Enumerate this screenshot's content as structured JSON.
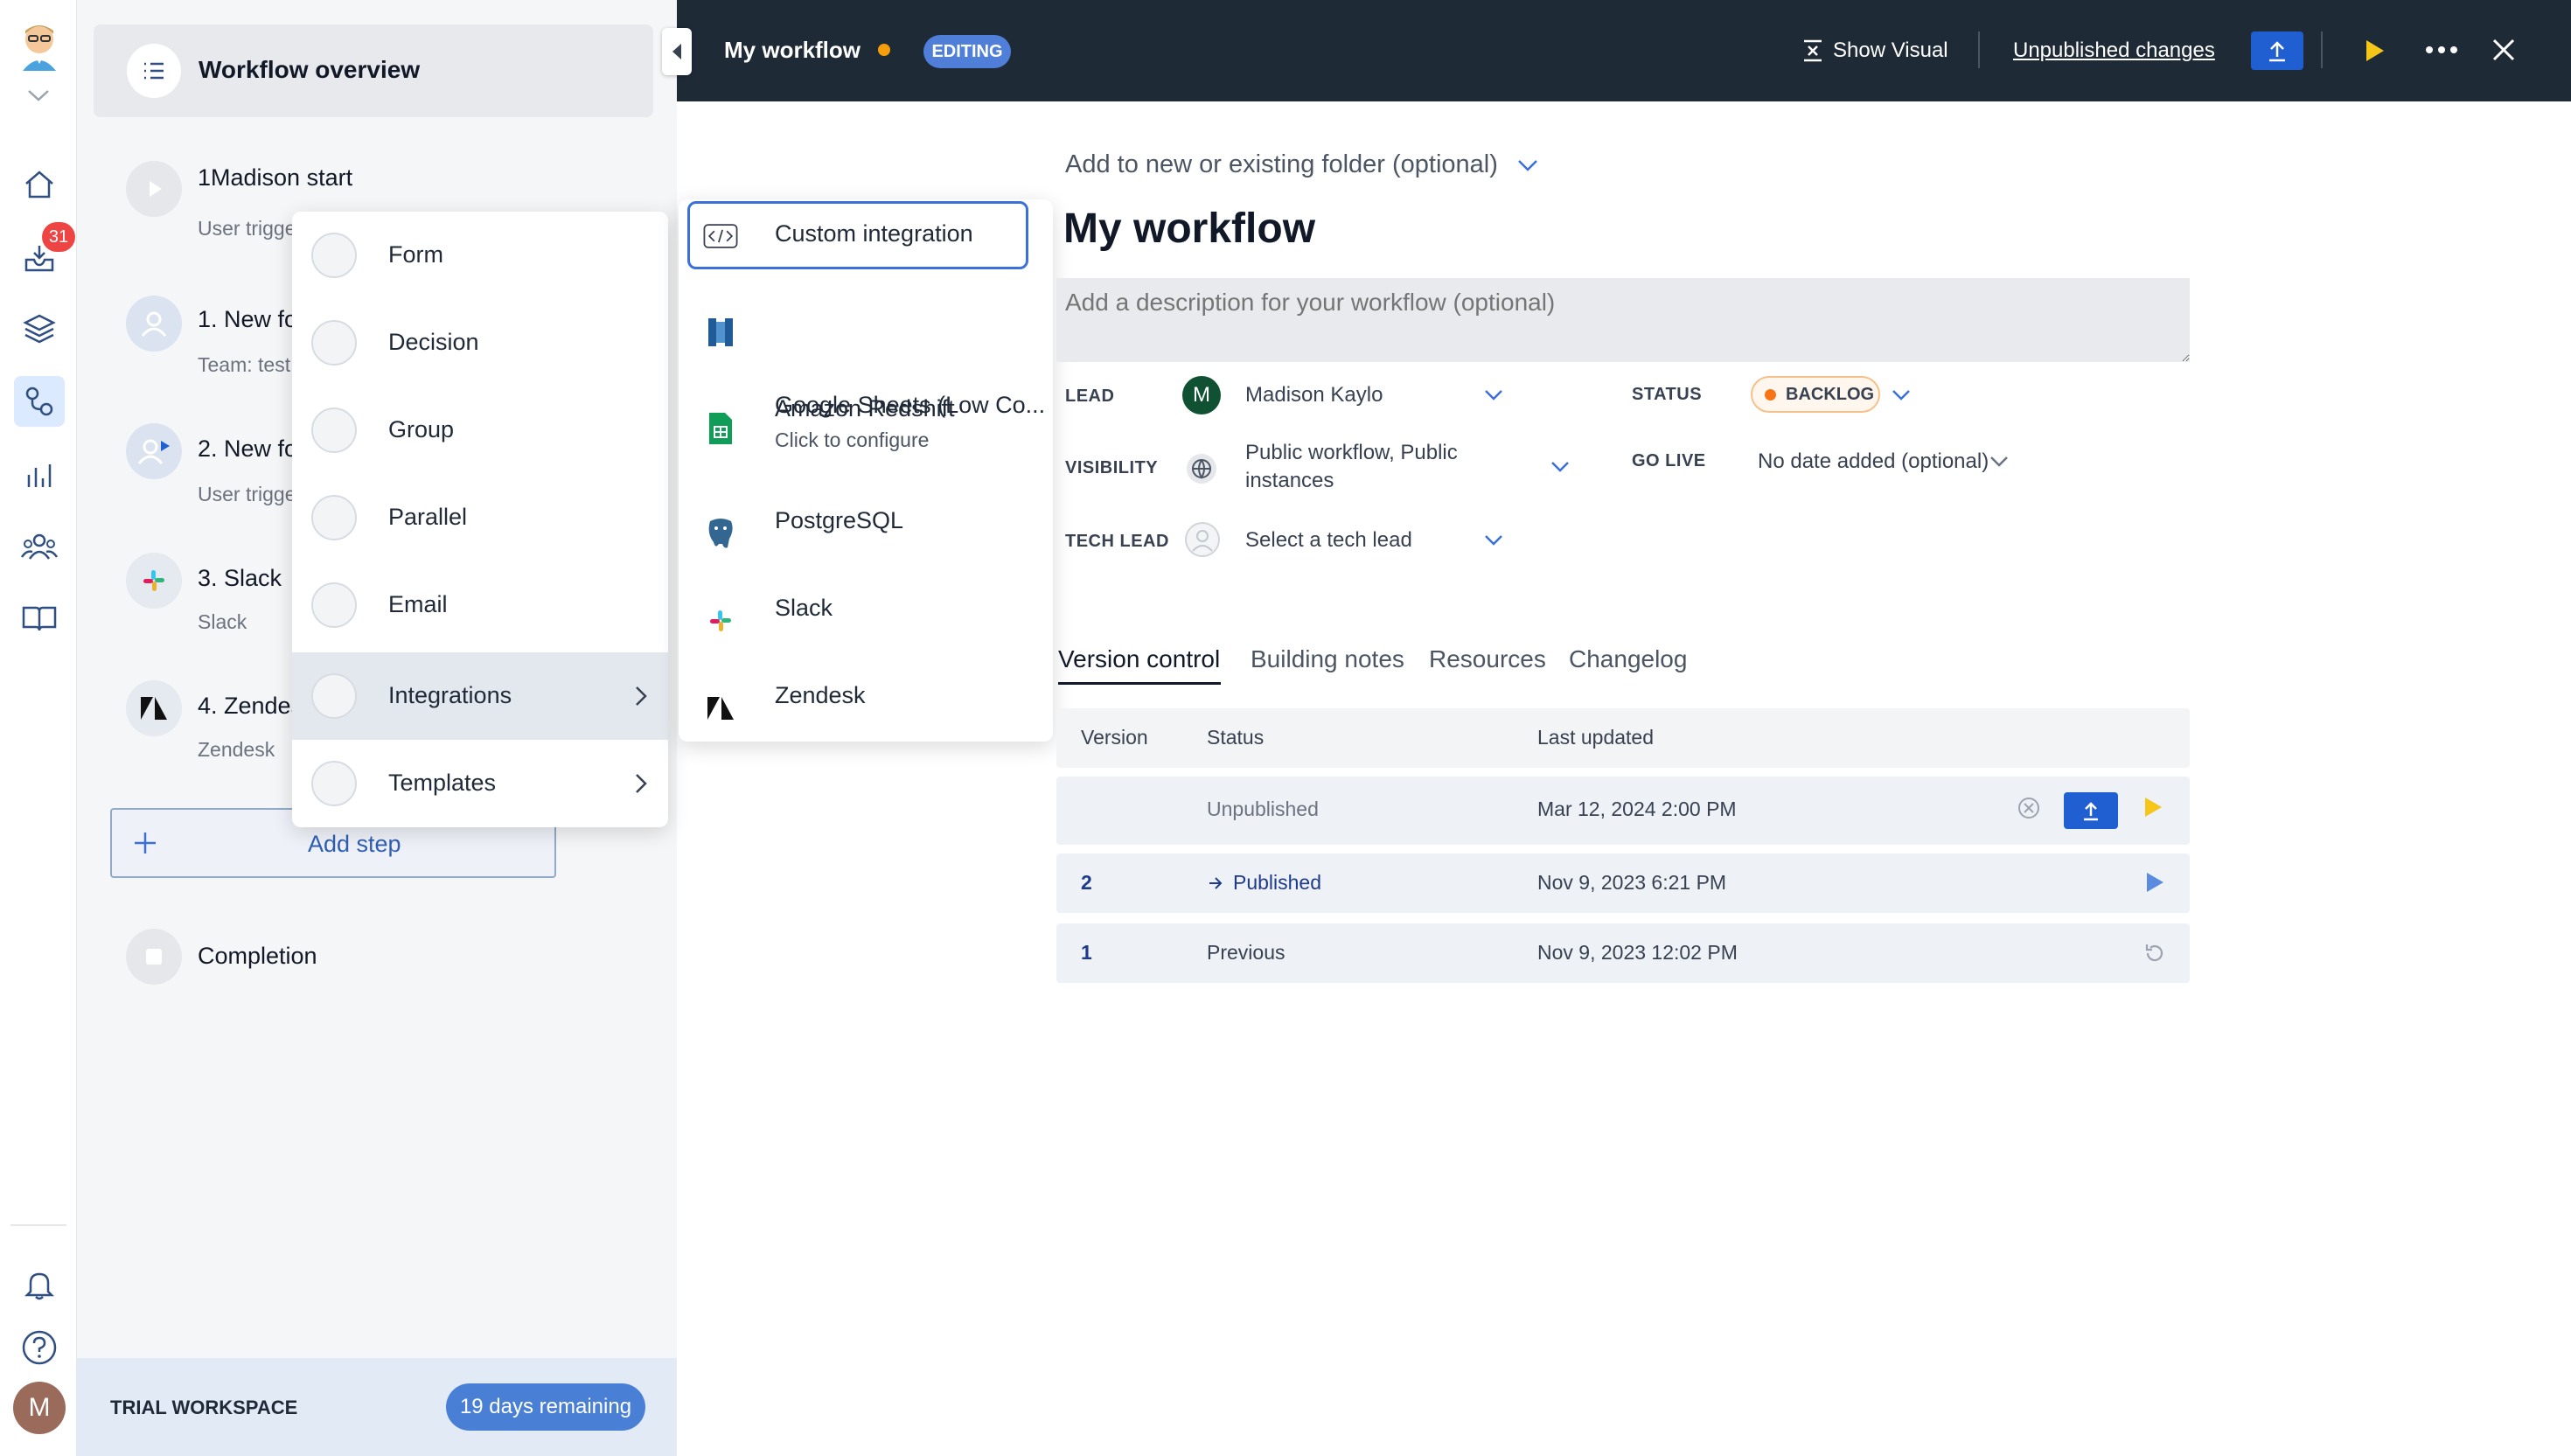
{
  "topbar": {
    "title": "My workflow",
    "mode_badge": "EDITING",
    "show_visual": "Show Visual",
    "unpublished_changes": "Unpublished changes"
  },
  "rail": {
    "inbox_count": "31",
    "avatar_initial": "M"
  },
  "sidebar": {
    "overview": "Workflow overview",
    "steps": [
      {
        "title": "1Madison start",
        "sub": "User trigge"
      },
      {
        "title": "1. New fo",
        "sub": "Team: test"
      },
      {
        "title": "2. New fo",
        "sub": "User trigge"
      },
      {
        "title": "3. Slack",
        "sub": "Slack"
      },
      {
        "title": "4. Zendes",
        "sub": "Zendesk"
      }
    ],
    "add_step": "Add step",
    "completion": "Completion",
    "trial_label": "TRIAL WORKSPACE",
    "days_remaining": "19 days remaining"
  },
  "step_menu": {
    "items": [
      "Form",
      "Decision",
      "Group",
      "Parallel",
      "Email",
      "Integrations",
      "Templates"
    ]
  },
  "integrations_menu": {
    "items": [
      {
        "label": "Custom integration",
        "icon": "code-icon"
      },
      {
        "label": "Amazon Redshift",
        "icon": "redshift-icon"
      },
      {
        "label": "Google Sheets (Low Co...",
        "sub": "Click to configure",
        "icon": "sheets-icon"
      },
      {
        "label": "PostgreSQL",
        "icon": "postgres-icon"
      },
      {
        "label": "Slack",
        "icon": "slack-icon"
      },
      {
        "label": "Zendesk",
        "icon": "zendesk-icon"
      }
    ]
  },
  "main": {
    "folder_placeholder": "Add to new or existing folder (optional)",
    "title": "My workflow",
    "description_placeholder": "Add a description for your workflow (optional)",
    "fields": {
      "lead_label": "LEAD",
      "lead_initial": "M",
      "lead_value": "Madison Kaylo",
      "visibility_label": "VISIBILITY",
      "visibility_line1": "Public workflow, Public",
      "visibility_line2": "instances",
      "tech_lead_label": "TECH LEAD",
      "tech_lead_value": "Select a tech lead",
      "status_label": "STATUS",
      "status_value": "BACKLOG",
      "go_live_label": "GO LIVE",
      "go_live_value": "No date added (optional)"
    },
    "tabs": [
      "Version control",
      "Building notes",
      "Resources",
      "Changelog"
    ],
    "table": {
      "headers": [
        "Version",
        "Status",
        "Last updated"
      ],
      "rows": [
        {
          "version": "",
          "status": "Unpublished",
          "updated": "Mar 12, 2024 2:00 PM"
        },
        {
          "version": "2",
          "status": "Published",
          "updated": "Nov 9, 2023 6:21 PM"
        },
        {
          "version": "1",
          "status": "Previous",
          "updated": "Nov 9, 2023 12:02 PM"
        }
      ]
    }
  },
  "colors": {
    "topbar_bg": "#1f2a37",
    "accent_blue": "#1f5fd1",
    "run_yellow": "#f5c518",
    "status_orange": "#f97316",
    "badge_red": "#ef4444"
  }
}
